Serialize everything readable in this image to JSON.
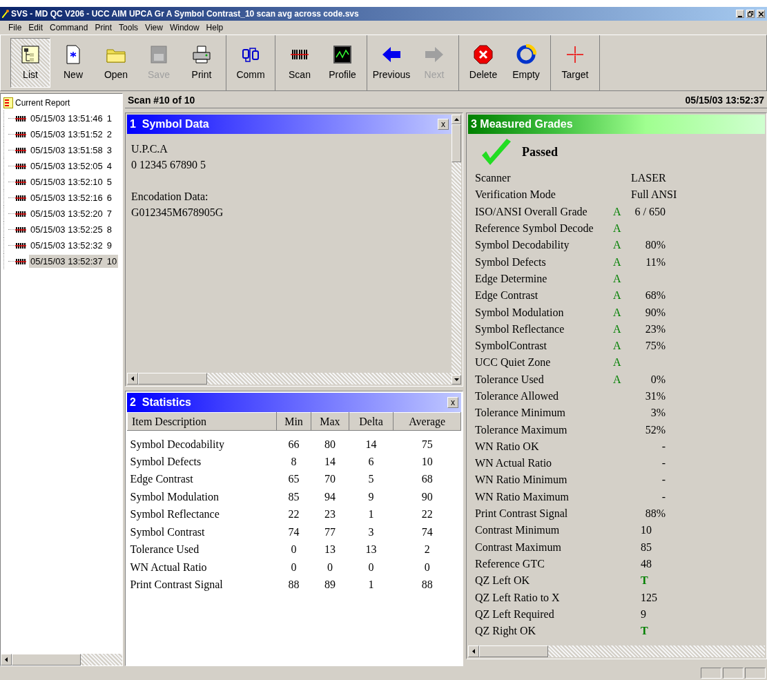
{
  "window": {
    "title": "SVS - MD QC V206 - UCC AIM UPCA Gr A Symbol Contrast_10 scan avg across code.svs"
  },
  "menu": [
    "File",
    "Edit",
    "Command",
    "Print",
    "Tools",
    "View",
    "Window",
    "Help"
  ],
  "toolbar": [
    {
      "buttons": [
        {
          "kind": "list",
          "label": "List",
          "selected": true,
          "disabled": false
        },
        {
          "kind": "new",
          "label": "New",
          "selected": false,
          "disabled": false
        },
        {
          "kind": "open",
          "label": "Open",
          "selected": false,
          "disabled": false
        },
        {
          "kind": "save",
          "label": "Save",
          "selected": false,
          "disabled": true
        },
        {
          "kind": "print",
          "label": "Print",
          "selected": false,
          "disabled": false
        }
      ]
    },
    {
      "buttons": [
        {
          "kind": "comm",
          "label": "Comm",
          "selected": false,
          "disabled": false
        }
      ]
    },
    {
      "buttons": [
        {
          "kind": "scan",
          "label": "Scan",
          "selected": false,
          "disabled": false
        },
        {
          "kind": "profile",
          "label": "Profile",
          "selected": false,
          "disabled": false
        }
      ]
    },
    {
      "buttons": [
        {
          "kind": "previous",
          "label": "Previous",
          "selected": false,
          "disabled": false
        },
        {
          "kind": "next",
          "label": "Next",
          "selected": false,
          "disabled": true
        }
      ]
    },
    {
      "buttons": [
        {
          "kind": "delete",
          "label": "Delete",
          "selected": false,
          "disabled": false
        },
        {
          "kind": "empty",
          "label": "Empty",
          "selected": false,
          "disabled": false
        }
      ]
    },
    {
      "buttons": [
        {
          "kind": "target",
          "label": "Target",
          "selected": false,
          "disabled": false
        }
      ]
    }
  ],
  "tree": {
    "root": "Current Report",
    "children": [
      {
        "time": "05/15/03 13:51:46",
        "number": "1",
        "selected": false
      },
      {
        "time": "05/15/03 13:51:52",
        "number": "2",
        "selected": false
      },
      {
        "time": "05/15/03 13:51:58",
        "number": "3",
        "selected": false
      },
      {
        "time": "05/15/03 13:52:05",
        "number": "4",
        "selected": false
      },
      {
        "time": "05/15/03 13:52:10",
        "number": "5",
        "selected": false
      },
      {
        "time": "05/15/03 13:52:16",
        "number": "6",
        "selected": false
      },
      {
        "time": "05/15/03 13:52:20",
        "number": "7",
        "selected": false
      },
      {
        "time": "05/15/03 13:52:25",
        "number": "8",
        "selected": false
      },
      {
        "time": "05/15/03 13:52:32",
        "number": "9",
        "selected": false
      },
      {
        "time": "05/15/03 13:52:37",
        "number": "10",
        "selected": true
      }
    ]
  },
  "header": {
    "scan": "Scan #10 of 10",
    "timestamp": "05/15/03 13:52:37"
  },
  "symbol_data": {
    "title": "1  Symbol Data",
    "close": "x",
    "blocks": [
      {
        "lines": [
          "U.P.C.A",
          "0 12345 67890 5"
        ]
      },
      {
        "lines": [
          "Encodation Data:",
          "G012345M678905G"
        ]
      }
    ]
  },
  "statistics": {
    "title": "2  Statistics",
    "close": "x",
    "columns": [
      "Item Description",
      "Min",
      "Max",
      "Delta",
      "Average"
    ],
    "rows": [
      [
        "Symbol Decodability",
        "66",
        "80",
        "14",
        "75"
      ],
      [
        "Symbol Defects",
        "8",
        "14",
        "6",
        "10"
      ],
      [
        "Edge Contrast",
        "65",
        "70",
        "5",
        "68"
      ],
      [
        "Symbol Modulation",
        "85",
        "94",
        "9",
        "90"
      ],
      [
        "Symbol Reflectance",
        "22",
        "23",
        "1",
        "22"
      ],
      [
        "Symbol Contrast",
        "74",
        "77",
        "3",
        "74"
      ],
      [
        "Tolerance Used",
        "0",
        "13",
        "13",
        "2"
      ],
      [
        "WN Actual Ratio",
        "0",
        "0",
        "0",
        "0"
      ],
      [
        "Print Contrast Signal",
        "88",
        "89",
        "1",
        "88"
      ]
    ]
  },
  "measured_grades": {
    "title": "3 Measured Grades",
    "result": {
      "label": "Passed",
      "passed": true
    },
    "rows": [
      {
        "label": "Scanner",
        "value": "LASER",
        "kind": "text"
      },
      {
        "label": "Verification Mode",
        "value": "Full ANSI",
        "kind": "text"
      },
      {
        "label": "ISO/ANSI Overall Grade",
        "grade": "A",
        "value": "6 / 650",
        "kind": "measure"
      },
      {
        "label": "Reference Symbol Decode",
        "grade": "A"
      },
      {
        "label": "Symbol Decodability",
        "grade": "A",
        "value": "80%",
        "kind": "measure"
      },
      {
        "label": "Symbol Defects",
        "grade": "A",
        "value": "11%",
        "kind": "measure"
      },
      {
        "label": "Edge Determine",
        "grade": "A"
      },
      {
        "label": "Edge Contrast",
        "grade": "A",
        "value": "68%",
        "kind": "measure"
      },
      {
        "label": "Symbol Modulation",
        "grade": "A",
        "value": "90%",
        "kind": "measure"
      },
      {
        "label": "Symbol Reflectance",
        "grade": "A",
        "value": "23%",
        "kind": "measure"
      },
      {
        "label": "SymbolContrast",
        "grade": "A",
        "value": "75%",
        "kind": "measure"
      },
      {
        "label": "UCC Quiet Zone",
        "grade": "A"
      },
      {
        "label": "Tolerance Used",
        "grade": "A",
        "value": "0%",
        "kind": "measure"
      },
      {
        "label": "Tolerance Allowed",
        "value": "31%",
        "kind": "measure"
      },
      {
        "label": "Tolerance Minimum",
        "value": "3%",
        "kind": "measure"
      },
      {
        "label": "Tolerance Maximum",
        "value": "52%",
        "kind": "measure"
      },
      {
        "label": "WN Ratio OK",
        "value": "-",
        "kind": "measure"
      },
      {
        "label": "WN Actual Ratio",
        "value": "-",
        "kind": "measure"
      },
      {
        "label": "WN Ratio Minimum",
        "value": "-",
        "kind": "measure"
      },
      {
        "label": "WN Ratio Maximum",
        "value": "-",
        "kind": "measure"
      },
      {
        "label": "Print Contrast Signal",
        "value": "88%",
        "kind": "measure"
      },
      {
        "label": "Contrast Minimum",
        "value": "10",
        "kind": "number"
      },
      {
        "label": "Contrast Maximum",
        "value": "85",
        "kind": "number"
      },
      {
        "label": "Reference GTC",
        "value": "48",
        "kind": "number"
      },
      {
        "label": "QZ Left OK",
        "value": "T",
        "kind": "flag"
      },
      {
        "label": "QZ Left Ratio to X",
        "value": "125",
        "kind": "number"
      },
      {
        "label": "QZ Left Required",
        "value": "9",
        "kind": "number"
      },
      {
        "label": "QZ Right OK",
        "value": "T",
        "kind": "flag"
      }
    ]
  }
}
